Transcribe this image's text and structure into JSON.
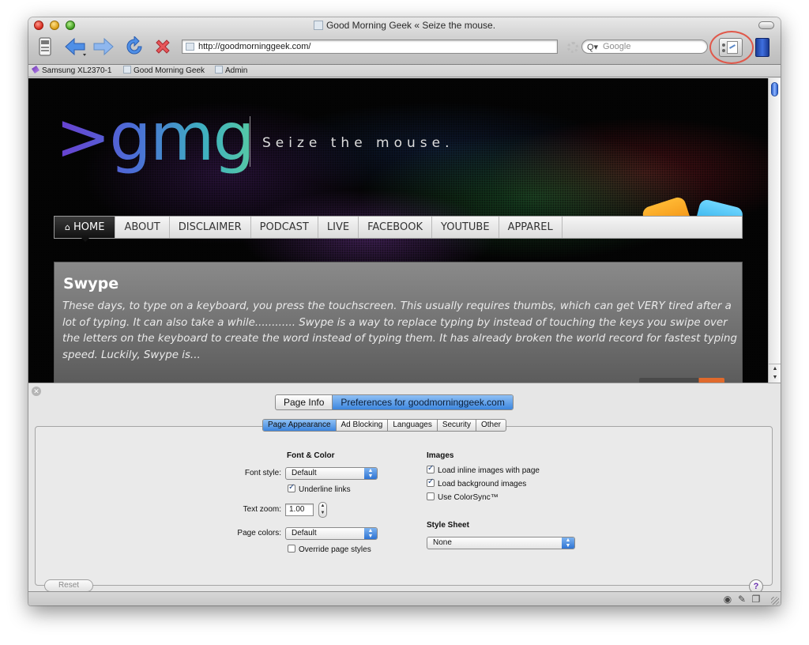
{
  "window": {
    "title": "Good Morning Geek « Seize the mouse."
  },
  "toolbar": {
    "url": "http://goodmorninggeek.com/",
    "search_placeholder": "Google"
  },
  "bookmarks": [
    {
      "label": "Samsung XL2370-1"
    },
    {
      "label": "Good Morning Geek"
    },
    {
      "label": "Admin"
    }
  ],
  "site": {
    "logo": ">gmg",
    "tagline": "Seize the mouse.",
    "nav": [
      "HOME",
      "ABOUT",
      "DISCLAIMER",
      "PODCAST",
      "LIVE",
      "FACEBOOK",
      "YOUTUBE",
      "APPAREL"
    ],
    "post_title": "Swype",
    "post_excerpt": "These days, to type on a keyboard, you press the touchscreen. This usually requires thumbs, which can get VERY tired after a lot of typing. It can also take a while............ Swype is a way to replace typing by instead of touching the keys you swipe over the letters on the keyboard to create the word instead of typing them. It has already broken the world record for fastest typing speed. Luckily, Swype is..."
  },
  "panel": {
    "top_tabs": [
      "Page Info",
      "Preferences for goodmorninggeek.com"
    ],
    "sub_tabs": [
      "Page Appearance",
      "Ad Blocking",
      "Languages",
      "Security",
      "Other"
    ],
    "font_color": {
      "heading": "Font & Color",
      "font_style_label": "Font style:",
      "font_style_value": "Default",
      "underline_links": "Underline links",
      "text_zoom_label": "Text zoom:",
      "text_zoom_value": "1.00",
      "page_colors_label": "Page colors:",
      "page_colors_value": "Default",
      "override_styles": "Override page styles"
    },
    "images": {
      "heading": "Images",
      "load_inline": "Load inline images with page",
      "load_background": "Load background images",
      "use_colorsync": "Use ColorSync™"
    },
    "style_sheet": {
      "heading": "Style Sheet",
      "value": "None"
    },
    "reset": "Reset",
    "help": "?"
  },
  "colors": {
    "accent": "#3d86de",
    "highlight_ring": "#e0584a"
  }
}
